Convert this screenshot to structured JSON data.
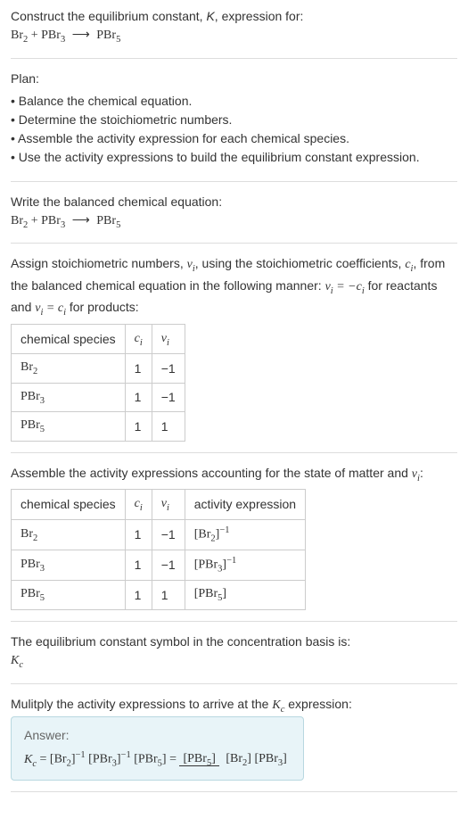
{
  "intro": {
    "text1": "Construct the equilibrium constant, ",
    "K": "K",
    "text2": ", expression for:"
  },
  "equation_display": "Br₂ + PBr₃ ⟶ PBr₅",
  "plan": {
    "title": "Plan:",
    "items": [
      "Balance the chemical equation.",
      "Determine the stoichiometric numbers.",
      "Assemble the activity expression for each chemical species.",
      "Use the activity expressions to build the equilibrium constant expression."
    ]
  },
  "balanced": {
    "title": "Write the balanced chemical equation:"
  },
  "stoich": {
    "text1": "Assign stoichiometric numbers, ",
    "nu_i": "νᵢ",
    "text2": ", using the stoichiometric coefficients, ",
    "c_i": "cᵢ",
    "text3": ", from the balanced chemical equation in the following manner: ",
    "rel1": "νᵢ = −cᵢ",
    "text4": " for reactants and ",
    "rel2": "νᵢ = cᵢ",
    "text5": " for products:",
    "headers": [
      "chemical species",
      "cᵢ",
      "νᵢ"
    ],
    "rows": [
      {
        "species": "Br₂",
        "c": "1",
        "nu": "−1"
      },
      {
        "species": "PBr₃",
        "c": "1",
        "nu": "−1"
      },
      {
        "species": "PBr₅",
        "c": "1",
        "nu": "1"
      }
    ]
  },
  "activity": {
    "text1": "Assemble the activity expressions accounting for the state of matter and ",
    "nu_i": "νᵢ",
    "text2": ":",
    "headers": [
      "chemical species",
      "cᵢ",
      "νᵢ",
      "activity expression"
    ],
    "rows": [
      {
        "species": "Br₂",
        "c": "1",
        "nu": "−1",
        "expr": "[Br₂]⁻¹"
      },
      {
        "species": "PBr₃",
        "c": "1",
        "nu": "−1",
        "expr": "[PBr₃]⁻¹"
      },
      {
        "species": "PBr₅",
        "c": "1",
        "nu": "1",
        "expr": "[PBr₅]"
      }
    ]
  },
  "symbol": {
    "text": "The equilibrium constant symbol in the concentration basis is:",
    "kc": "K_c"
  },
  "multiply": {
    "text1": "Mulitply the activity expressions to arrive at the ",
    "kc": "K_c",
    "text2": " expression:"
  },
  "answer": {
    "label": "Answer:",
    "kc": "K_c",
    "eq": " = ",
    "terms": "[Br₂]⁻¹ [PBr₃]⁻¹ [PBr₅]",
    "eq2": " = ",
    "num": "[PBr₅]",
    "den": "[Br₂] [PBr₃]"
  }
}
